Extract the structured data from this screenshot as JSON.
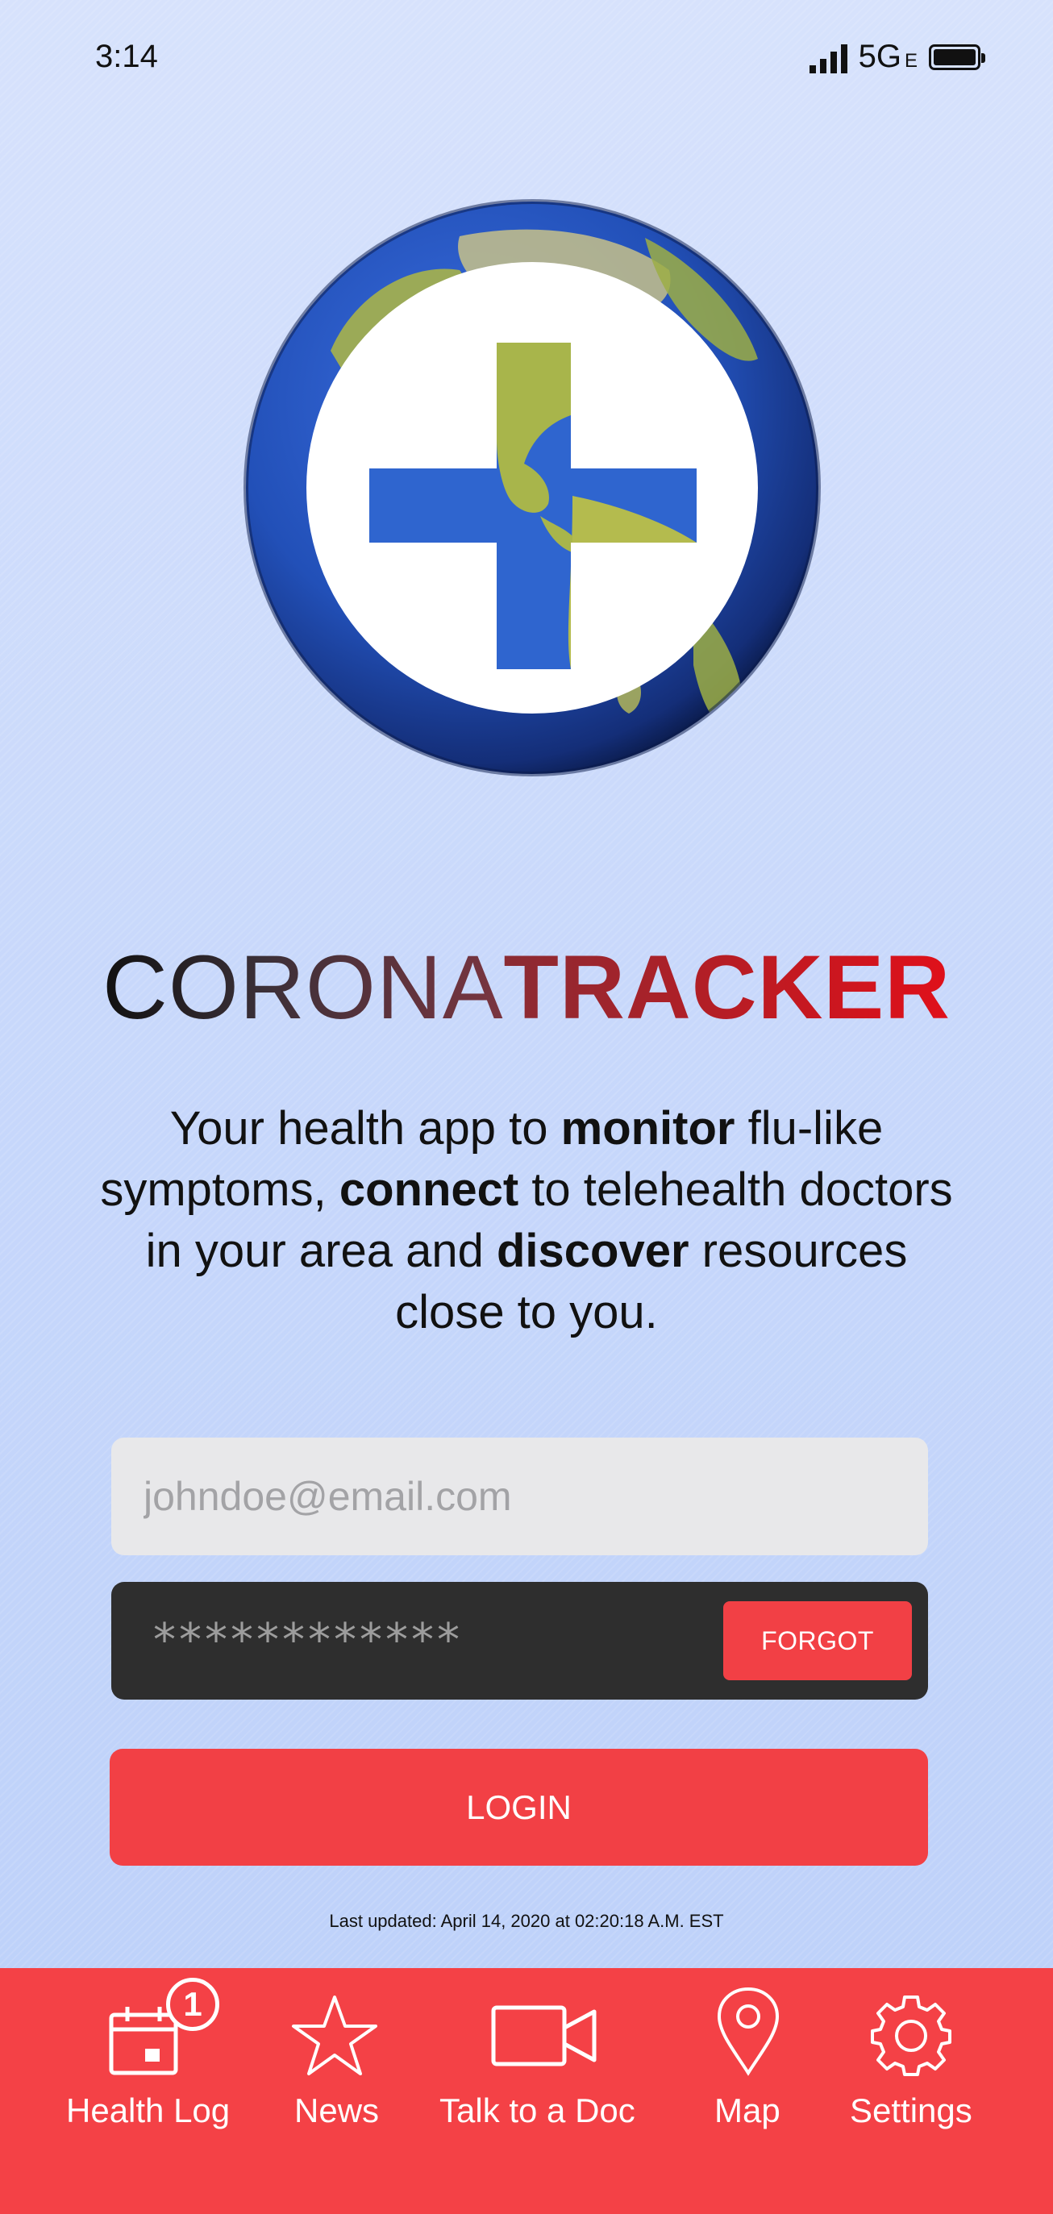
{
  "status_bar": {
    "time": "3:14",
    "network": "5G",
    "network_sub": "E"
  },
  "brand": {
    "light": "CORONA",
    "bold": "TRACKER"
  },
  "tagline": {
    "p1": "Your health app to ",
    "b1": "monitor",
    "p2": " flu-like symptoms, ",
    "b2": "connect",
    "p3": " to telehealth doctors in your area and ",
    "b3": "discover",
    "p4": " resources close to you."
  },
  "login_form": {
    "email_placeholder": "johndoe@email.com",
    "password_value": "************",
    "forgot_label": "FORGOT",
    "login_label": "LOGIN"
  },
  "last_updated": "Last updated: April 14, 2020 at 02:20:18 A.M. EST",
  "tab_bar": {
    "items": [
      {
        "label": "Health Log",
        "icon": "calendar-icon",
        "badge": "1"
      },
      {
        "label": "News",
        "icon": "star-icon"
      },
      {
        "label": "Talk to a Doc",
        "icon": "video-camera-icon"
      },
      {
        "label": "Map",
        "icon": "map-pin-icon"
      },
      {
        "label": "Settings",
        "icon": "gear-icon"
      }
    ]
  },
  "colors": {
    "accent": "#f44146",
    "background": "#c8d8fb",
    "input_light": "#e8e8ea",
    "input_dark": "#2e2e2e",
    "brand_red": "#d0121c"
  }
}
